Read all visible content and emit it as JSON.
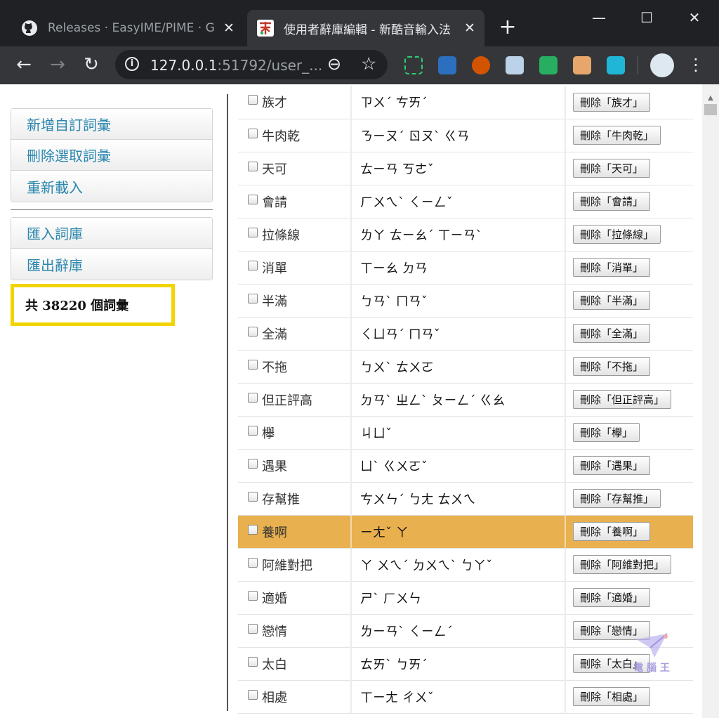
{
  "browser": {
    "tabs": [
      {
        "title": "Releases · EasyIME/PIME · GitHub",
        "close": "✕"
      },
      {
        "title": "使用者辭庫編輯 - 新酷音輸入法",
        "close": "✕"
      }
    ],
    "new_tab": "+",
    "window": {
      "minimize": "—",
      "maximize": "☐",
      "close": "✕"
    },
    "nav": {
      "back": "←",
      "forward": "→",
      "reload": "↻",
      "menu": "⋮"
    },
    "url": {
      "host": "127.0.0.1",
      "rest": ":51792/user_...",
      "info": "i"
    },
    "zoom_icon": "⊖",
    "star_icon": "☆",
    "extensions": [
      "screenshot-icon",
      "search-ext-icon",
      "owl-icon",
      "notes-icon",
      "mail-icon",
      "box-icon",
      "arrow-ext-icon"
    ]
  },
  "sidebar": {
    "group1": [
      "新增自訂詞彙",
      "刪除選取詞彙",
      "重新載入"
    ],
    "group2": [
      "匯入詞庫",
      "匯出辭庫"
    ],
    "count_text": "共 38220 個詞彙"
  },
  "table": {
    "rows": [
      {
        "word": "族才",
        "bopomofo": "ㄗㄨˊ ㄘㄞˊ",
        "delete": "刪除「族才」"
      },
      {
        "word": "牛肉乾",
        "bopomofo": "ㄋㄧㄡˊ ㄖㄡˋ ㄍㄢ",
        "delete": "刪除「牛肉乾」"
      },
      {
        "word": "天可",
        "bopomofo": "ㄊㄧㄢ ㄎㄜˇ",
        "delete": "刪除「天可」"
      },
      {
        "word": "會請",
        "bopomofo": "ㄏㄨㄟˋ ㄑㄧㄥˇ",
        "delete": "刪除「會請」"
      },
      {
        "word": "拉條線",
        "bopomofo": "ㄌㄚ ㄊㄧㄠˊ ㄒㄧㄢˋ",
        "delete": "刪除「拉條線」"
      },
      {
        "word": "消單",
        "bopomofo": "ㄒㄧㄠ ㄉㄢ",
        "delete": "刪除「消單」"
      },
      {
        "word": "半滿",
        "bopomofo": "ㄅㄢˋ ㄇㄢˇ",
        "delete": "刪除「半滿」"
      },
      {
        "word": "全滿",
        "bopomofo": "ㄑㄩㄢˊ ㄇㄢˇ",
        "delete": "刪除「全滿」"
      },
      {
        "word": "不拖",
        "bopomofo": "ㄅㄨˋ ㄊㄨㄛ",
        "delete": "刪除「不拖」"
      },
      {
        "word": "但正評高",
        "bopomofo": "ㄉㄢˋ ㄓㄥˋ ㄆㄧㄥˊ ㄍㄠ",
        "delete": "刪除「但正評高」"
      },
      {
        "word": "欅",
        "bopomofo": "ㄐㄩˇ",
        "delete": "刪除「欅」"
      },
      {
        "word": "遇果",
        "bopomofo": "ㄩˋ ㄍㄨㄛˇ",
        "delete": "刪除「遇果」"
      },
      {
        "word": "存幫推",
        "bopomofo": "ㄘㄨㄣˊ ㄅㄤ ㄊㄨㄟ",
        "delete": "刪除「存幫推」"
      },
      {
        "word": "養啊",
        "bopomofo": "ㄧㄤˇ ㄚ",
        "delete": "刪除「養啊」"
      },
      {
        "word": "阿維對把",
        "bopomofo": "ㄚ ㄨㄟˊ ㄉㄨㄟˋ ㄅㄚˇ",
        "delete": "刪除「阿維對把」"
      },
      {
        "word": "適婚",
        "bopomofo": "ㄕˋ ㄏㄨㄣ",
        "delete": "刪除「適婚」"
      },
      {
        "word": "戀情",
        "bopomofo": "ㄌㄧㄢˋ ㄑㄧㄥˊ",
        "delete": "刪除「戀情」"
      },
      {
        "word": "太白",
        "bopomofo": "ㄊㄞˋ ㄅㄞˊ",
        "delete": "刪除「太白」"
      },
      {
        "word": "相處",
        "bopomofo": "ㄒㄧㄤ ㄔㄨˇ",
        "delete": "刪除「相處」"
      }
    ],
    "highlight_row": 13,
    "highlight_color": "#e8b04e"
  },
  "watermark": {
    "text": "電 腦 王"
  },
  "colors": {
    "link": "#2a86ad",
    "count_border": "#f2d400",
    "chrome_dark": "#202124",
    "chrome_toolbar": "#35363a"
  }
}
